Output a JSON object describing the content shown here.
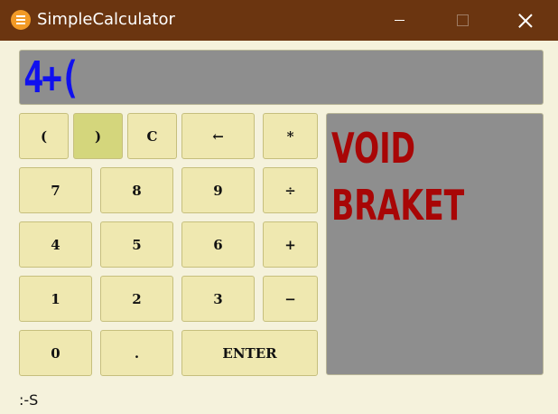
{
  "window": {
    "title": "SimpleCalculator",
    "icon": "calculator-app-icon",
    "controls": [
      "minimize-icon",
      "maximize-icon",
      "close-icon"
    ]
  },
  "display": {
    "expression": "4+("
  },
  "keys": {
    "open_paren": "(",
    "close_paren": ")",
    "clear": "C",
    "backspace": "←",
    "multiply": "*",
    "seven": "7",
    "eight": "8",
    "nine": "9",
    "divide": "÷",
    "four": "4",
    "five": "5",
    "six": "6",
    "plus": "+",
    "one": "1",
    "two": "2",
    "three": "3",
    "minus": "−",
    "zero": "0",
    "dot": ".",
    "enter": "ENTER"
  },
  "message": {
    "line1": "VOID",
    "line2": "BRAKET"
  },
  "status": {
    "text": ":-S"
  },
  "colors": {
    "titlebar": "#6b3510",
    "background": "#f5f2dc",
    "key": "#efe8b0",
    "key_active": "#d4d67c",
    "panel": "#8e8e8e",
    "display_text": "#1010ee",
    "message_text": "#a80606"
  }
}
